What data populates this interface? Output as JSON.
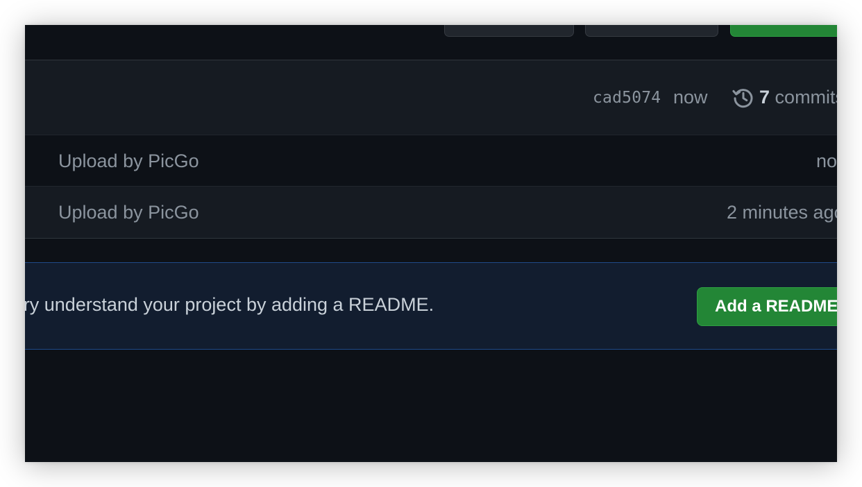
{
  "header": {
    "buttons": [
      {
        "name": "header-button-1",
        "style": "secondary"
      },
      {
        "name": "header-button-2",
        "style": "secondary"
      },
      {
        "name": "header-button-3",
        "style": "primary"
      }
    ]
  },
  "latest_commit": {
    "sha": "cad5074",
    "time": "now",
    "history_icon": "history-icon",
    "commits_count": "7",
    "commits_label": "commits"
  },
  "files": [
    {
      "message": "Upload by PicGo",
      "time": "now"
    },
    {
      "message": "Upload by PicGo",
      "time": "2 minutes ago"
    }
  ],
  "readme_banner": {
    "text": "Help people interested in this repository understand your project by adding a README.",
    "button_label": "Add a README"
  },
  "colors": {
    "background": "#0d1117",
    "surface": "#161b22",
    "border": "#30363d",
    "muted_text": "#8b949e",
    "primary_text": "#c9d1d9",
    "accent_green": "#238636",
    "banner_bg": "#121d2f",
    "banner_border": "#1f4a8a"
  }
}
